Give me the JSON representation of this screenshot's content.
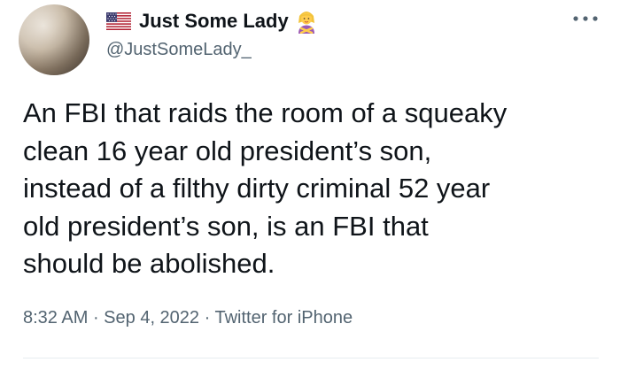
{
  "author": {
    "display_name": "Just Some Lady",
    "handle": "@JustSomeLady_",
    "flag_icon": "us-flag-icon",
    "emoji_icon": "person-gesturing-no-icon"
  },
  "tweet": {
    "lines": [
      "An FBI that raids the room of a squeaky",
      "clean 16 year old president’s son,",
      "instead of a filthy dirty criminal 52 year",
      "old president’s son, is an FBI that",
      "should be abolished."
    ]
  },
  "meta": {
    "time": "8:32 AM",
    "sep1": " · ",
    "date": "Sep 4, 2022",
    "sep2": " · ",
    "source": "Twitter for iPhone"
  },
  "colors": {
    "text_primary": "#0f1419",
    "text_secondary": "#536471",
    "divider": "#e6ecf0"
  }
}
